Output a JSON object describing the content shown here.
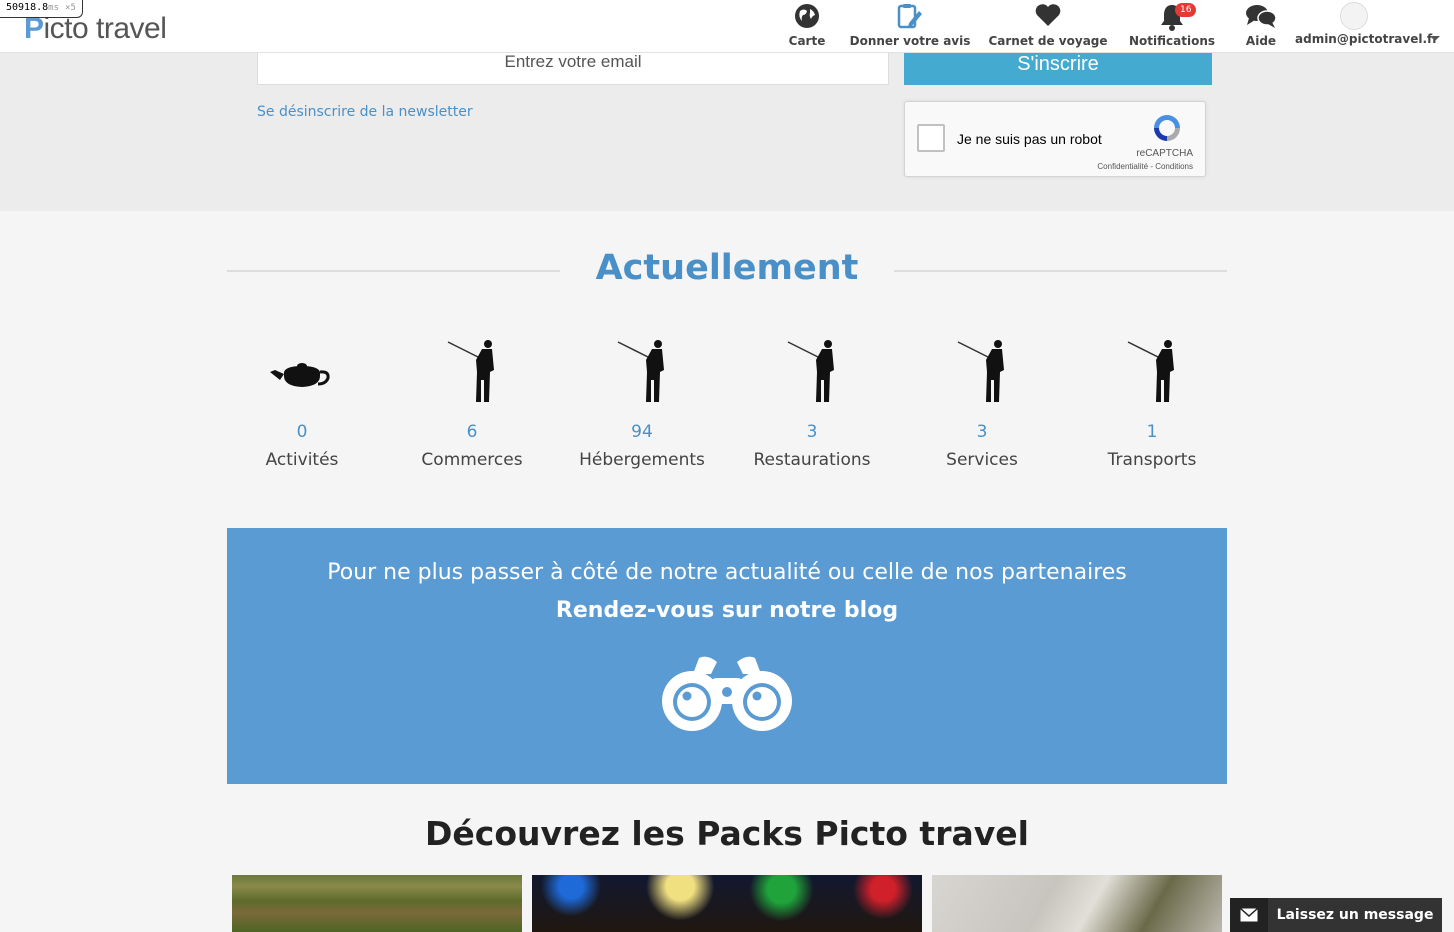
{
  "debug": {
    "timing": "50918.8",
    "unit": "ms",
    "multiplier": "×5"
  },
  "header": {
    "logo": {
      "initial": "P",
      "rest": "icto travel"
    },
    "nav": [
      {
        "label": "Carte",
        "icon": "globe-icon"
      },
      {
        "label": "Donner votre avis",
        "icon": "clipboard-edit-icon"
      },
      {
        "label": "Carnet de voyage",
        "icon": "heart-icon"
      },
      {
        "label": "Notifications",
        "icon": "bell-icon",
        "badge": "16"
      },
      {
        "label": "Aide",
        "icon": "chat-bubbles-icon"
      }
    ],
    "user": {
      "email": "admin@pictotravel.fr"
    }
  },
  "newsletter": {
    "email_placeholder": "Entrez votre email",
    "subscribe_label": "S'inscrire",
    "unsubscribe_link": "Se désinscrire de la newsletter",
    "captcha": {
      "label": "Je ne suis pas un robot",
      "brand": "reCAPTCHA",
      "links": "Confidentialité - Conditions"
    }
  },
  "stats": {
    "title": "Actuellement",
    "items": [
      {
        "count": "0",
        "label": "Activités",
        "icon": "teapot-icon"
      },
      {
        "count": "6",
        "label": "Commerces",
        "icon": "fisherman-icon"
      },
      {
        "count": "94",
        "label": "Hébergements",
        "icon": "fisherman-icon"
      },
      {
        "count": "3",
        "label": "Restaurations",
        "icon": "fisherman-icon"
      },
      {
        "count": "3",
        "label": "Services",
        "icon": "fisherman-icon"
      },
      {
        "count": "1",
        "label": "Transports",
        "icon": "fisherman-icon"
      }
    ]
  },
  "blog": {
    "line1": "Pour ne plus passer à côté de notre actualité ou celle de nos partenaires",
    "line2": "Rendez-vous sur notre blog",
    "icon": "binoculars-icon"
  },
  "packs": {
    "title": "Découvrez les Packs Picto travel"
  },
  "chat": {
    "label": "Laissez un message",
    "icon": "envelope-icon"
  },
  "colors": {
    "accent": "#4a90c8",
    "banner": "#5b9bd3",
    "button": "#44aad0",
    "badge": "#e53935"
  }
}
